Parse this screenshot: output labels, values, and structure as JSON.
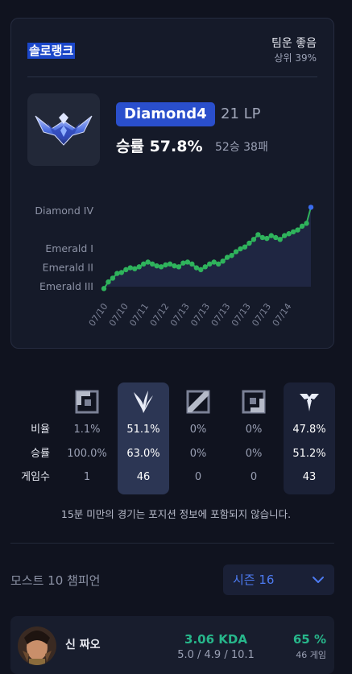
{
  "rank_card": {
    "queue_title": "솔로랭크",
    "team_luck": "팀운 좋음",
    "percentile": "상위 39%",
    "tier": "Diamond4",
    "lp": "21 LP",
    "winrate_label": "승률 57.8%",
    "record": "52승 38패",
    "emblem_icon": "diamond-emblem-icon"
  },
  "chart_data": {
    "type": "line",
    "title": "",
    "xlabel": "",
    "ylabel": "",
    "y_tick_labels": [
      "Diamond IV",
      "Emerald I",
      "Emerald II",
      "Emerald III"
    ],
    "x_tick_labels": [
      "07/10",
      "07/10",
      "07/11",
      "07/12",
      "07/13",
      "07/13",
      "07/13",
      "07/13",
      "07/13",
      "07/14"
    ],
    "y_scale_note": "tier ladder: 0 = Emerald III, 1 = Emerald II, 2 = Emerald I, 4 = Diamond IV",
    "ylim": [
      0,
      4.6
    ],
    "grid": false,
    "line_color": "#2fb35c",
    "last_point_color": "#3a6cf0",
    "values": [
      -0.1,
      0.25,
      0.45,
      0.7,
      0.75,
      0.9,
      1.0,
      0.95,
      1.05,
      1.2,
      1.3,
      1.2,
      1.1,
      1.05,
      1.15,
      1.2,
      1.1,
      1.05,
      1.25,
      1.3,
      1.2,
      1.0,
      0.9,
      1.05,
      1.2,
      1.3,
      1.2,
      1.35,
      1.55,
      1.65,
      1.85,
      2.0,
      2.1,
      2.3,
      2.5,
      2.75,
      2.6,
      2.55,
      2.7,
      2.6,
      2.5,
      2.7,
      2.8,
      2.9,
      3.0,
      3.2,
      3.35,
      4.2
    ]
  },
  "positions": {
    "row_labels": [
      "비율",
      "승률",
      "게임수"
    ],
    "columns": [
      {
        "icon": "top-lane-icon",
        "ratio": "1.1%",
        "winrate": "100.0%",
        "games": "1",
        "highlight": false
      },
      {
        "icon": "jungle-icon",
        "ratio": "51.1%",
        "winrate": "63.0%",
        "games": "46",
        "highlight": true,
        "highlight_color": "#2c3654"
      },
      {
        "icon": "mid-lane-icon",
        "ratio": "0%",
        "winrate": "0%",
        "games": "0",
        "highlight": false
      },
      {
        "icon": "bottom-lane-icon",
        "ratio": "0%",
        "winrate": "0%",
        "games": "0",
        "highlight": false
      },
      {
        "icon": "support-icon",
        "ratio": "47.8%",
        "winrate": "51.2%",
        "games": "43",
        "highlight": true,
        "highlight_color": "#1b2136"
      }
    ],
    "notice": "15분 미만의 경기는 포지션 정보에 포함되지 않습니다."
  },
  "most_champions": {
    "title": "모스트 10 챔피언",
    "season_select": "시즌 16",
    "items": [
      {
        "name": "신 짜오",
        "kda": "3.06 KDA",
        "kda_detail": "5.0 / 4.9 / 10.1",
        "winrate": "65 %",
        "games": "46 게임"
      }
    ]
  }
}
